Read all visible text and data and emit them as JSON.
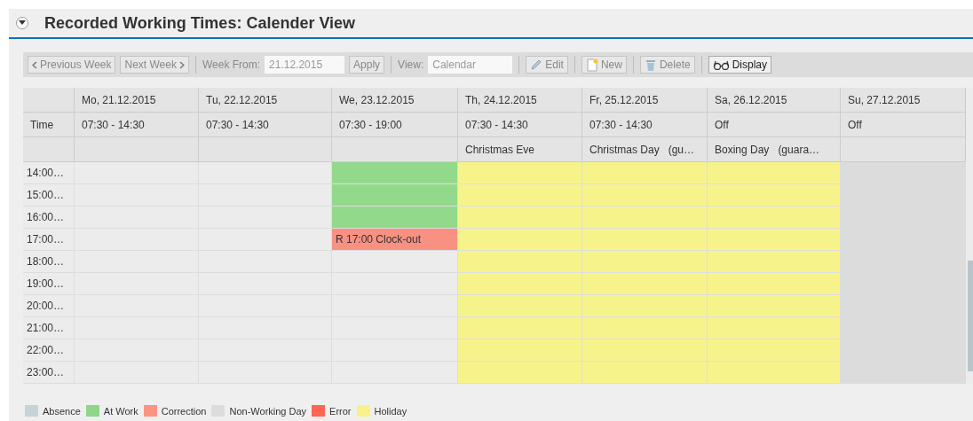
{
  "panel": {
    "title": "Recorded Working Times: Calender View",
    "expanded": true
  },
  "toolbar": {
    "previous": "Previous Week",
    "next": "Next Week",
    "week_from_label": "Week From:",
    "week_from_value": "21.12.2015",
    "apply": "Apply",
    "view_label": "View:",
    "view_value": "Calendar",
    "buttons": [
      {
        "label": "Edit",
        "disabled": true
      },
      {
        "label": "New",
        "disabled": true
      },
      {
        "label": "Delete",
        "disabled": true
      },
      {
        "label": "Display",
        "disabled": false
      }
    ]
  },
  "calendar": {
    "time_label": "Time",
    "hours": [
      "14:00…",
      "15:00…",
      "16:00…",
      "17:00…",
      "18:00…",
      "19:00…",
      "20:00…",
      "21:00…",
      "22:00…",
      "23:00…"
    ],
    "days": [
      {
        "date": "Mo, 21.12.2015",
        "time": "07:30 - 14:30",
        "cells": [
          {
            "kind": "empty"
          },
          {
            "kind": "empty"
          },
          {
            "kind": "empty"
          },
          {
            "kind": "empty"
          },
          {
            "kind": "empty"
          },
          {
            "kind": "empty"
          },
          {
            "kind": "empty"
          },
          {
            "kind": "empty"
          },
          {
            "kind": "empty"
          },
          {
            "kind": "empty"
          }
        ]
      },
      {
        "date": "Tu, 22.12.2015",
        "time": "07:30 - 14:30",
        "cells": [
          {
            "kind": "empty"
          },
          {
            "kind": "empty"
          },
          {
            "kind": "empty"
          },
          {
            "kind": "empty"
          },
          {
            "kind": "empty"
          },
          {
            "kind": "empty"
          },
          {
            "kind": "empty"
          },
          {
            "kind": "empty"
          },
          {
            "kind": "empty"
          },
          {
            "kind": "empty"
          }
        ]
      },
      {
        "date": "We, 23.12.2015",
        "time": "07:30 - 19:00",
        "cells": [
          {
            "kind": "work"
          },
          {
            "kind": "work"
          },
          {
            "kind": "work"
          },
          {
            "kind": "correction",
            "text": "R 17:00 Clock-out"
          },
          {
            "kind": "empty"
          },
          {
            "kind": "empty"
          },
          {
            "kind": "empty"
          },
          {
            "kind": "empty"
          },
          {
            "kind": "empty"
          },
          {
            "kind": "empty"
          }
        ]
      },
      {
        "date": "Th, 24.12.2015",
        "time": "07:30 - 14:30",
        "note": "Christmas Eve",
        "cells": [
          {
            "kind": "holiday"
          },
          {
            "kind": "holiday"
          },
          {
            "kind": "holiday"
          },
          {
            "kind": "holiday"
          },
          {
            "kind": "holiday"
          },
          {
            "kind": "holiday"
          },
          {
            "kind": "holiday"
          },
          {
            "kind": "holiday"
          },
          {
            "kind": "holiday"
          },
          {
            "kind": "holiday"
          }
        ]
      },
      {
        "date": "Fr, 25.12.2015",
        "time": "07:30 - 14:30",
        "note": "Christmas Day",
        "note_extra": "(gu…",
        "cells": [
          {
            "kind": "holiday"
          },
          {
            "kind": "holiday"
          },
          {
            "kind": "holiday"
          },
          {
            "kind": "holiday"
          },
          {
            "kind": "holiday"
          },
          {
            "kind": "holiday"
          },
          {
            "kind": "holiday"
          },
          {
            "kind": "holiday"
          },
          {
            "kind": "holiday"
          },
          {
            "kind": "holiday"
          }
        ]
      },
      {
        "date": "Sa, 26.12.2015",
        "time": "Off",
        "note": "Boxing Day",
        "note_extra": "(guara…",
        "cells": [
          {
            "kind": "holiday"
          },
          {
            "kind": "holiday"
          },
          {
            "kind": "holiday"
          },
          {
            "kind": "holiday"
          },
          {
            "kind": "holiday"
          },
          {
            "kind": "holiday"
          },
          {
            "kind": "holiday"
          },
          {
            "kind": "holiday"
          },
          {
            "kind": "holiday"
          },
          {
            "kind": "holiday"
          }
        ]
      },
      {
        "date": "Su, 27.12.2015",
        "time": "Off",
        "cells": [
          {
            "kind": "nonworking"
          },
          {
            "kind": "nonworking"
          },
          {
            "kind": "nonworking"
          },
          {
            "kind": "nonworking"
          },
          {
            "kind": "nonworking"
          },
          {
            "kind": "nonworking"
          },
          {
            "kind": "nonworking"
          },
          {
            "kind": "nonworking"
          },
          {
            "kind": "nonworking"
          },
          {
            "kind": "nonworking"
          }
        ]
      }
    ]
  },
  "legend": [
    {
      "label": "Absence",
      "color": "#c5d4db"
    },
    {
      "label": "At Work",
      "color": "#8fd68a"
    },
    {
      "label": "Correction",
      "color": "#fb9483"
    },
    {
      "label": "Non-Working Day",
      "color": "#dcdcdc"
    },
    {
      "label": "Error",
      "color": "#ff6454"
    },
    {
      "label": "Holiday",
      "color": "#f7f28a"
    }
  ]
}
